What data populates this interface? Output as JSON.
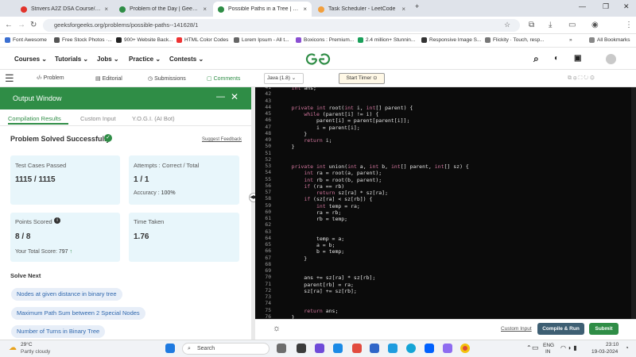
{
  "browser": {
    "tabs": [
      {
        "label": "Strivers A2Z DSA Course/Sheet",
        "color": "#e2332b"
      },
      {
        "label": "Problem of the Day | GeeksforG",
        "color": "#2f8d46"
      },
      {
        "label": "Possible Paths in a Tree | Practic",
        "color": "#2f8d46"
      },
      {
        "label": "Task Scheduler - LeetCode",
        "color": "#f29f3d"
      }
    ],
    "url": "geeksforgeeks.org/problems/possible-paths--141628/1",
    "bookmarks": [
      {
        "label": "Font Awesome",
        "color": "#3b6fd1"
      },
      {
        "label": "Free Stock Photos ·...",
        "color": "#555"
      },
      {
        "label": "900+ Website Back...",
        "color": "#222"
      },
      {
        "label": "HTML Color Codes",
        "color": "#e33"
      },
      {
        "label": "Lorem Ipsum - All t...",
        "color": "#666"
      },
      {
        "label": "Boxicons : Premium...",
        "color": "#8a4fd2"
      },
      {
        "label": "2.4 million+ Stunnin...",
        "color": "#1aa05a"
      },
      {
        "label": "Responsive Image S...",
        "color": "#333"
      },
      {
        "label": "Flickity · Touch, resp...",
        "color": "#777"
      }
    ],
    "all_bookmarks": "All Bookmarks"
  },
  "site": {
    "menu": [
      "Courses",
      "Tutorials",
      "Jobs",
      "Practice",
      "Contests"
    ],
    "logo": "GfG"
  },
  "toolbar": {
    "tabs": [
      "Problem",
      "Editorial",
      "Submissions",
      "Comments"
    ],
    "language": "Java (1.8)",
    "start_timer": "Start Timer"
  },
  "output": {
    "title": "Output Window",
    "tabs": [
      "Compilation Results",
      "Custom Input",
      "Y.O.G.I. (AI Bot)"
    ],
    "status": "Problem Solved Successfully",
    "suggest": "Suggest Feedback",
    "test_cases_label": "Test Cases Passed",
    "test_cases_value": "1115 / 1115",
    "attempts_label": "Attempts : Correct / Total",
    "attempts_value": "1 / 1",
    "accuracy_label": "Accuracy :",
    "accuracy_value": "100%",
    "points_label": "Points Scored",
    "points_value": "8 / 8",
    "total_score_label": "Your Total Score:",
    "total_score_value": "797",
    "time_label": "Time Taken",
    "time_value": "1.76",
    "solve_next": "Solve Next",
    "next": [
      "Nodes at given distance in binary tree",
      "Maximum Path Sum between 2 Special Nodes",
      "Number of Turns in Binary Tree"
    ]
  },
  "editor": {
    "lines": [
      {
        "n": "41",
        "t": "    int ans;"
      },
      {
        "n": "42",
        "t": ""
      },
      {
        "n": "43",
        "t": ""
      },
      {
        "n": "44",
        "t": "    private int root(int i, int[] parent) {"
      },
      {
        "n": "45",
        "t": "        while (parent[i] != i) {"
      },
      {
        "n": "46",
        "t": "            parent[i] = parent[parent[i]];"
      },
      {
        "n": "47",
        "t": "            i = parent[i];"
      },
      {
        "n": "48",
        "t": "        }"
      },
      {
        "n": "49",
        "t": "        return i;"
      },
      {
        "n": "50",
        "t": "    }"
      },
      {
        "n": "51",
        "t": ""
      },
      {
        "n": "52",
        "t": ""
      },
      {
        "n": "53",
        "t": "    private int union(int a, int b, int[] parent, int[] sz) {"
      },
      {
        "n": "54",
        "t": "        int ra = root(a, parent);"
      },
      {
        "n": "55",
        "t": "        int rb = root(b, parent);"
      },
      {
        "n": "56",
        "t": "        if (ra == rb)"
      },
      {
        "n": "57",
        "t": "            return sz[ra] * sz[ra];"
      },
      {
        "n": "58",
        "t": "        if (sz[ra] < sz[rb]) {"
      },
      {
        "n": "59",
        "t": "            int temp = ra;"
      },
      {
        "n": "60",
        "t": "            ra = rb;"
      },
      {
        "n": "61",
        "t": "            rb = temp;"
      },
      {
        "n": "62",
        "t": ""
      },
      {
        "n": "63",
        "t": ""
      },
      {
        "n": "64",
        "t": "            temp = a;"
      },
      {
        "n": "65",
        "t": "            a = b;"
      },
      {
        "n": "66",
        "t": "            b = temp;"
      },
      {
        "n": "67",
        "t": "        }"
      },
      {
        "n": "68",
        "t": ""
      },
      {
        "n": "69",
        "t": ""
      },
      {
        "n": "70",
        "t": "        ans += sz[ra] * sz[rb];"
      },
      {
        "n": "71",
        "t": "        parent[rb] = ra;"
      },
      {
        "n": "72",
        "t": "        sz[ra] += sz[rb];"
      },
      {
        "n": "73",
        "t": ""
      },
      {
        "n": "74",
        "t": ""
      },
      {
        "n": "75",
        "t": "        return ans;"
      },
      {
        "n": "76",
        "t": "    }"
      }
    ],
    "custom_input": "Custom Input",
    "compile_run": "Compile & Run",
    "submit": "Submit"
  },
  "taskbar": {
    "temp": "29°C",
    "weather": "Partly cloudy",
    "search": "Search",
    "lang_top": "ENG",
    "lang_bottom": "IN",
    "time": "23:10",
    "date": "19-03-2024"
  }
}
